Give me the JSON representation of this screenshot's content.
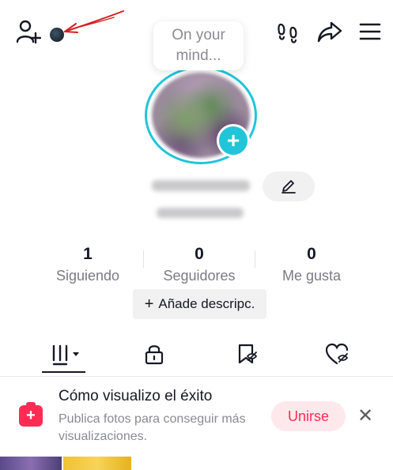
{
  "header": {
    "icons": [
      "add-friend-icon",
      "footprints-icon",
      "share-icon",
      "menu-icon"
    ]
  },
  "bubble": {
    "line1": "On your",
    "line2": "mind..."
  },
  "stats": [
    {
      "num": "1",
      "label": "Siguiendo"
    },
    {
      "num": "0",
      "label": "Seguidores"
    },
    {
      "num": "0",
      "label": "Me gusta"
    }
  ],
  "description_button": {
    "plus": "+",
    "label": "Añade descripc."
  },
  "tabs": [
    "videos-grid-icon",
    "lock-icon",
    "bookmark-icon",
    "liked-heart-icon"
  ],
  "banner": {
    "title": "Cómo visualizo el éxito",
    "subtitle": "Publica fotos para conseguir más visualizaciones.",
    "join_label": "Unirse",
    "close_label": "✕"
  },
  "colors": {
    "accent_cyan": "#21c5d9",
    "brand_red": "#fe2c55",
    "join_bg": "#fde8ec",
    "text_primary": "#161823",
    "text_secondary": "#7a7b82"
  }
}
